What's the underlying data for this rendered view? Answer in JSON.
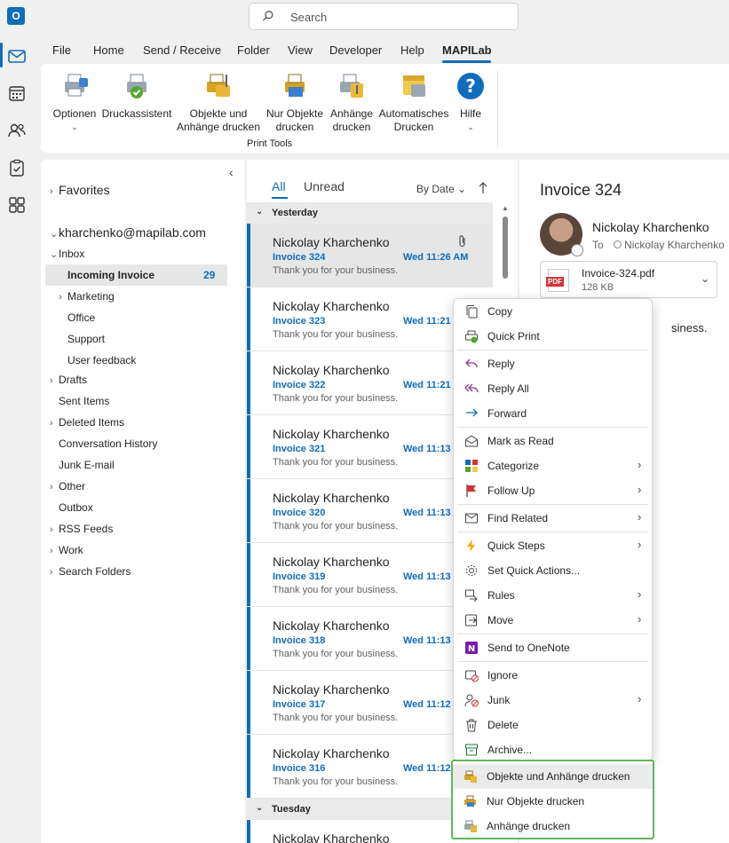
{
  "search": {
    "placeholder": "Search"
  },
  "menu_tabs": [
    "File",
    "Home",
    "Send / Receive",
    "Folder",
    "View",
    "Developer",
    "Help",
    "MAPILab"
  ],
  "ribbon": {
    "buttons": [
      {
        "label": "Optionen",
        "icon": "printer-options-icon"
      },
      {
        "label": "Druckassistent",
        "icon": "print-wizard-icon"
      },
      {
        "label": "Objekte und\nAnhänge drucken",
        "icon": "print-items-attachments-icon"
      },
      {
        "label": "Nur Objekte\ndrucken",
        "icon": "print-items-icon"
      },
      {
        "label": "Anhänge\ndrucken",
        "icon": "print-attachments-icon"
      },
      {
        "label": "Automatisches\nDrucken",
        "icon": "auto-print-icon"
      },
      {
        "label": "Hilfe",
        "icon": "help-icon"
      }
    ],
    "group_label": "Print Tools"
  },
  "folders": {
    "favorites": "Favorites",
    "account": "kharchenko@mapilab.com",
    "inbox": "Inbox",
    "selected": {
      "label": "Incoming Invoice",
      "count": "29"
    },
    "items": [
      "Marketing",
      "Office",
      "Support",
      "User feedback",
      "Drafts",
      "Sent Items",
      "Deleted Items",
      "Conversation History",
      "Junk E-mail",
      "Other",
      "Outbox",
      "RSS Feeds",
      "Work",
      "Search Folders"
    ]
  },
  "list": {
    "filter_all": "All",
    "filter_unread": "Unread",
    "sort": "By Date",
    "section_yesterday": "Yesterday",
    "section_tuesday": "Tuesday",
    "messages": [
      {
        "from": "Nickolay Kharchenko",
        "subject": "Invoice 324",
        "time": "Wed 11:26 AM",
        "preview": "Thank you for your business."
      },
      {
        "from": "Nickolay Kharchenko",
        "subject": "Invoice 323",
        "time": "Wed 11:21",
        "preview": "Thank you for your business."
      },
      {
        "from": "Nickolay Kharchenko",
        "subject": "Invoice 322",
        "time": "Wed 11:21",
        "preview": "Thank you for your business."
      },
      {
        "from": "Nickolay Kharchenko",
        "subject": "Invoice 321",
        "time": "Wed 11:13",
        "preview": "Thank you for your business."
      },
      {
        "from": "Nickolay Kharchenko",
        "subject": "Invoice 320",
        "time": "Wed 11:13",
        "preview": "Thank you for your business."
      },
      {
        "from": "Nickolay Kharchenko",
        "subject": "Invoice 319",
        "time": "Wed 11:13",
        "preview": "Thank you for your business."
      },
      {
        "from": "Nickolay Kharchenko",
        "subject": "Invoice 318",
        "time": "Wed 11:13",
        "preview": "Thank you for your business."
      },
      {
        "from": "Nickolay Kharchenko",
        "subject": "Invoice 317",
        "time": "Wed 11:12",
        "preview": "Thank you for your business."
      },
      {
        "from": "Nickolay Kharchenko",
        "subject": "Invoice 316",
        "time": "Wed 11:12",
        "preview": "Thank you for your business."
      }
    ],
    "last_from": "Nickolay Kharchenko"
  },
  "reading": {
    "subject": "Invoice 324",
    "sender": "Nickolay Kharchenko",
    "to_label": "To",
    "to_name": "Nickolay Kharchenko",
    "attachment_name": "Invoice-324.pdf",
    "attachment_size": "128 KB",
    "pdf_badge": "PDF",
    "body_visible": "siness."
  },
  "context_menu": {
    "items": [
      "Copy",
      "Quick Print",
      "Reply",
      "Reply All",
      "Forward",
      "Mark as Read",
      "Categorize",
      "Follow Up",
      "Find Related",
      "Quick Steps",
      "Set Quick Actions...",
      "Rules",
      "Move",
      "Send to OneNote",
      "Ignore",
      "Junk",
      "Delete",
      "Archive..."
    ],
    "addin_items": [
      "Objekte und Anhänge drucken",
      "Nur Objekte drucken",
      "Anhänge drucken"
    ]
  },
  "colors": {
    "accent": "#0f6cbd",
    "highlight_border": "#5cb85c"
  }
}
